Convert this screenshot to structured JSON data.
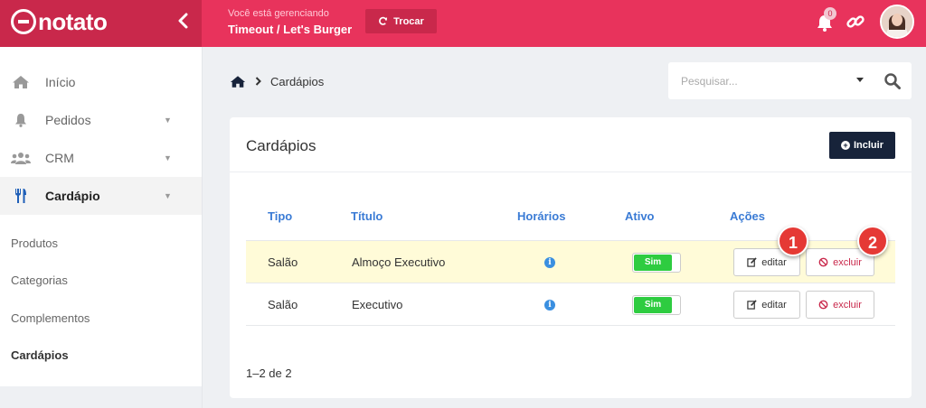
{
  "brand": {
    "logo_text": "notato"
  },
  "header": {
    "managing_label": "Você está gerenciando",
    "store_name": "Timeout / Let's Burger",
    "switch_label": "Trocar",
    "notification_count": "0"
  },
  "sidebar": {
    "items": [
      {
        "label": "Início",
        "icon": "home-icon"
      },
      {
        "label": "Pedidos",
        "icon": "bell-icon"
      },
      {
        "label": "CRM",
        "icon": "users-icon"
      },
      {
        "label": "Cardápio",
        "icon": "cutlery-icon"
      }
    ],
    "subitems": [
      "Produtos",
      "Categorias",
      "Complementos",
      "Cardápios"
    ]
  },
  "breadcrumb": {
    "current": "Cardápios"
  },
  "search": {
    "placeholder": "Pesquisar..."
  },
  "card": {
    "title": "Cardápios",
    "add_label": "Incluir",
    "columns": [
      "Tipo",
      "Título",
      "Horários",
      "Ativo",
      "Ações"
    ],
    "rows": [
      {
        "tipo": "Salão",
        "titulo": "Almoço Executivo",
        "ativo": "Sim",
        "edit_label": "editar",
        "delete_label": "excluir"
      },
      {
        "tipo": "Salão",
        "titulo": "Executivo",
        "ativo": "Sim",
        "edit_label": "editar",
        "delete_label": "excluir"
      }
    ],
    "pagination": "1–2 de 2"
  },
  "markers": [
    "1",
    "2"
  ],
  "colors": {
    "brand": "#e8335c",
    "brand_dark": "#c9284b",
    "accent_blue": "#3a7bd5",
    "toggle_on": "#2ecc40",
    "highlight_row": "#fffbd8"
  }
}
